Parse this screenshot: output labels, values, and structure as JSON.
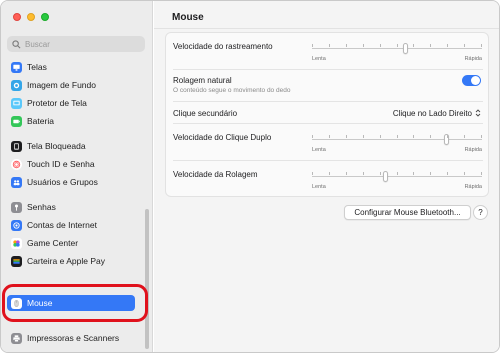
{
  "search": {
    "placeholder": "Buscar"
  },
  "sidebar": {
    "items": [
      {
        "label": "Telas",
        "icon": "display-icon",
        "color": "#3478f6"
      },
      {
        "label": "Imagem de Fundo",
        "icon": "wallpaper-icon",
        "color": "#35a6e8"
      },
      {
        "label": "Protetor de Tela",
        "icon": "screensaver-icon",
        "color": "#5ac8fa"
      },
      {
        "label": "Bateria",
        "icon": "battery-icon",
        "color": "#34c759"
      },
      {
        "label": "Tela Bloqueada",
        "icon": "lock-screen-icon",
        "color": "#1d1d1f"
      },
      {
        "label": "Touch ID e Senha",
        "icon": "fingerprint-icon",
        "color": "#ff5a5f"
      },
      {
        "label": "Usuários e Grupos",
        "icon": "users-icon",
        "color": "#3478f6"
      },
      {
        "label": "Senhas",
        "icon": "key-icon",
        "color": "#8e8e93"
      },
      {
        "label": "Contas de Internet",
        "icon": "at-icon",
        "color": "#3478f6"
      },
      {
        "label": "Game Center",
        "icon": "game-center-icon",
        "color": "#ff9f0a"
      },
      {
        "label": "Carteira e Apple Pay",
        "icon": "wallet-icon",
        "color": "#1d1d1f"
      },
      {
        "label": "Mouse",
        "icon": "mouse-icon",
        "color": "#ffffff"
      },
      {
        "label": "Impressoras e Scanners",
        "icon": "printer-icon",
        "color": "#8e8e93"
      }
    ],
    "selected": "Mouse"
  },
  "main": {
    "title": "Mouse",
    "tracking": {
      "label": "Velocidade do rastreamento",
      "min": "Lenta",
      "max": "Rápida",
      "value": 0.55
    },
    "natural_scroll": {
      "label": "Rolagem natural",
      "sub": "O conteúdo segue o movimento do dedo",
      "on": true
    },
    "secondary_click": {
      "label": "Clique secundário",
      "value": "Clique no Lado Direito"
    },
    "double_click": {
      "label": "Velocidade do Clique Duplo",
      "min": "Lenta",
      "max": "Rápida",
      "value": 0.8
    },
    "scroll_speed": {
      "label": "Velocidade da Rolagem",
      "min": "Lenta",
      "max": "Rápida",
      "value": 0.43
    },
    "bluetooth_button": "Configurar Mouse Bluetooth...",
    "help_button": "?"
  },
  "colors": {
    "accent": "#3478f6",
    "highlight_ring": "#e0111c"
  }
}
